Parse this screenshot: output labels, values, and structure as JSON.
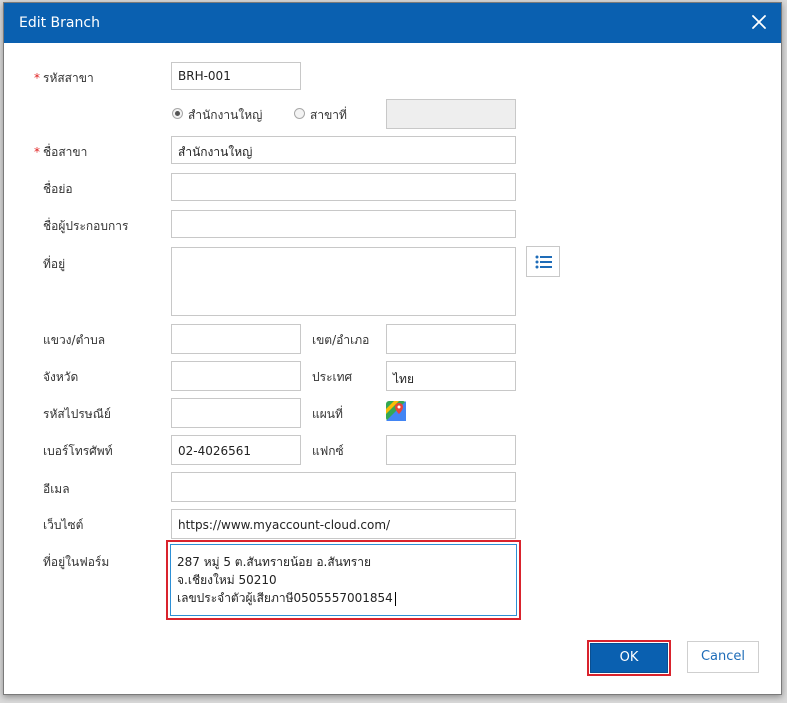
{
  "dialog": {
    "title": "Edit Branch",
    "close_icon": "close-icon"
  },
  "colors": {
    "titlebar": "#0a60b0",
    "required": "#e02020",
    "highlight": "#d9232d",
    "ok_button": "#0a60b0"
  },
  "form": {
    "branch_code": {
      "label": "รหัสสาขา",
      "required_mark": "*",
      "value": "BRH-001"
    },
    "branch_type": {
      "options": [
        {
          "label": "สำนักงานใหญ่",
          "checked": true
        },
        {
          "label": "สาขาที่",
          "checked": false
        }
      ],
      "branch_no_value": ""
    },
    "branch_name": {
      "label": "ชื่อสาขา",
      "required_mark": "*",
      "value": "สำนักงานใหญ่"
    },
    "short_name": {
      "label": "ชื่อย่อ",
      "value": ""
    },
    "operator_name": {
      "label": "ชื่อผู้ประกอบการ",
      "value": ""
    },
    "address": {
      "label": "ที่อยู่",
      "value": "",
      "list_icon": "list-icon"
    },
    "subdistrict": {
      "label": "แขวง/ตำบล",
      "value": ""
    },
    "district": {
      "label": "เขต/อำเภอ",
      "value": ""
    },
    "province": {
      "label": "จังหวัด",
      "value": ""
    },
    "country": {
      "label": "ประเทศ",
      "value": "ไทย"
    },
    "postal_code": {
      "label": "รหัสไปรษณีย์",
      "value": ""
    },
    "map": {
      "label": "แผนที่",
      "icon": "google-maps-icon"
    },
    "phone": {
      "label": "เบอร์โทรศัพท์",
      "value": "02-4026561"
    },
    "fax": {
      "label": "แฟกซ์",
      "value": ""
    },
    "email": {
      "label": "อีเมล",
      "value": ""
    },
    "website": {
      "label": "เว็บไซต์",
      "value": "https://www.myaccount-cloud.com/"
    },
    "form_address": {
      "label": "ที่อยู่ในฟอร์ม",
      "lines": [
        "287 หมู่ 5 ต.สันทรายน้อย อ.สันทราย",
        "จ.เชียงใหม่ 50210",
        "เลขประจำตัวผู้เสียภาษี0505557001854"
      ]
    }
  },
  "buttons": {
    "ok": "OK",
    "cancel": "Cancel"
  }
}
